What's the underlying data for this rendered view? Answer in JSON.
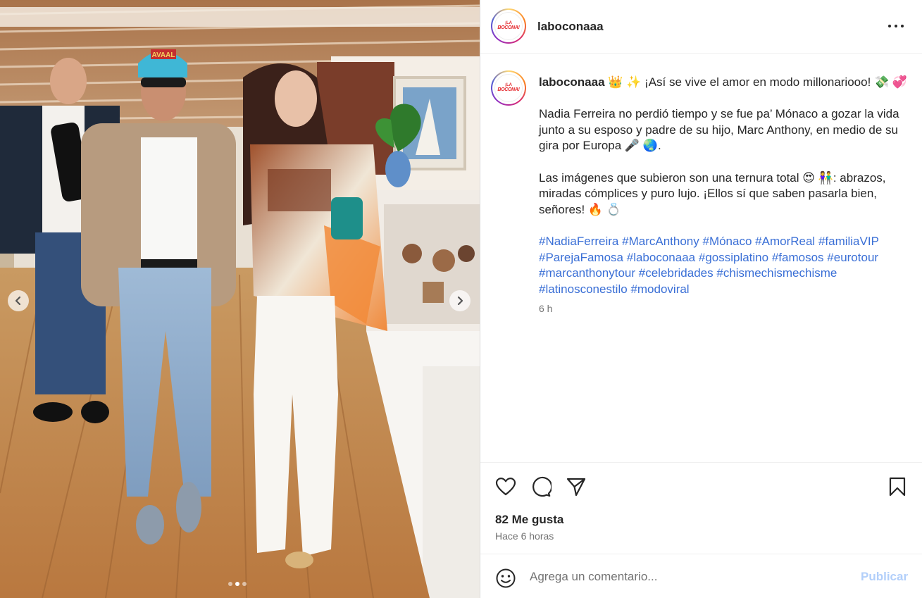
{
  "post": {
    "username": "laboconaaa",
    "avatar_logo_line1": "¡LA",
    "avatar_logo_line2": "BOCONA!",
    "more_icon": "more-horizontal-icon",
    "caption": {
      "username": "laboconaaa",
      "line1": " 👑 ✨ ¡Así se vive el amor en modo millonariooo! 💸 💞",
      "paragraph2": "Nadia Ferreira no perdió tiempo y se fue pa’ Mónaco a gozar la vida junto a su esposo y padre de su hijo, Marc Anthony, en medio de su gira por Europa 🎤 🌏.",
      "paragraph3": "Las imágenes que subieron son una ternura total 😍 👫: abrazos, miradas cómplices y puro lujo. ¡Ellos sí que saben pasarla bien, señores! 🔥 💍",
      "hashtags": [
        "#NadiaFerreira",
        "#MarcAnthony",
        "#Mónaco",
        "#AmorReal",
        "#familiaVIP",
        "#ParejaFamosa",
        "#laboconaaa",
        "#gossiplatino",
        "#famosos",
        "#eurotour",
        "#marcanthonytour",
        "#celebridades",
        "#chismechismechisme",
        "#latinosconestilo",
        "#modoviral"
      ],
      "time": "6 h"
    },
    "likes": "82 Me gusta",
    "posted_ago": "Hace 6 horas",
    "comment_placeholder": "Agrega un comentario...",
    "publish_label": "Publicar"
  },
  "carousel": {
    "total_slides": 3,
    "active_slide": 2,
    "hat_text": "AVAAL"
  },
  "colors": {
    "hashtag": "#3a6fd6",
    "publish_disabled": "#b2cffa",
    "secondary_text": "#737373"
  }
}
